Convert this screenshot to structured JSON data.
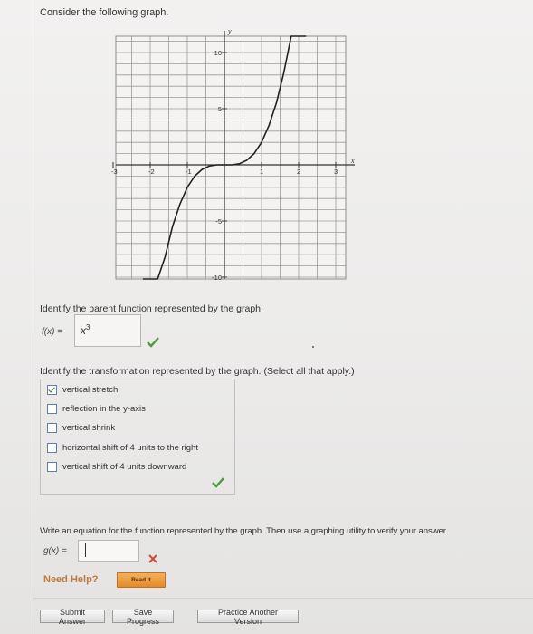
{
  "heading": "Consider the following graph.",
  "chart_data": {
    "type": "line",
    "function": "y = 2x^3 grid plot",
    "series": [
      {
        "x": [
          -2.2,
          -2.0,
          -1.8,
          -1.6,
          -1.4,
          -1.2,
          -1.0,
          -0.8,
          -0.6,
          -0.4,
          -0.2,
          0,
          0.2,
          0.4,
          0.6,
          0.8,
          1.0,
          1.2,
          1.4,
          1.6,
          1.8,
          2.0,
          2.2
        ],
        "y": [
          -21.3,
          -16,
          -11.7,
          -8.2,
          -5.5,
          -3.5,
          -2,
          -1,
          -0.4,
          -0.1,
          0,
          0,
          0,
          0.1,
          0.4,
          1,
          2,
          3.5,
          5.5,
          8.2,
          11.7,
          16,
          21.3
        ]
      }
    ],
    "xlabel": "x",
    "ylabel": "y",
    "xlim": [
      -3.3,
      3.3
    ],
    "ylim": [
      -12,
      12
    ],
    "xticks": [
      "-3",
      "-2",
      "-1",
      "1",
      "2",
      "3"
    ],
    "yticks": [
      "10",
      "5",
      "-5",
      "-10"
    ],
    "grid": true
  },
  "q1": {
    "prompt": "Identify the parent function represented by the graph.",
    "label": "f(x)  =",
    "answer_base": "x",
    "answer_exp": "3"
  },
  "q2": {
    "prompt": "Identify the transformation represented by the graph. (Select all that apply.)",
    "options": [
      {
        "label": "vertical stretch",
        "checked": true
      },
      {
        "label": "reflection in the y-axis",
        "checked": false
      },
      {
        "label": "vertical shrink",
        "checked": false
      },
      {
        "label": "horizontal shift of 4 units to the right",
        "checked": false
      },
      {
        "label": "vertical shift of 4 units downward",
        "checked": false
      }
    ]
  },
  "q3": {
    "prompt": "Write an equation for the function represented by the graph. Then use a graphing utility to verify your answer.",
    "label": "g(x)  =",
    "value": ""
  },
  "help": {
    "need_help": "Need Help?",
    "read_it": "Read It"
  },
  "footer": {
    "submit": "Submit Answer",
    "save": "Save Progress",
    "practice": "Practice Another Version"
  },
  "colors": {
    "check": "#4c9a3c",
    "x_mark": "#d24a3a",
    "help_orange": "#c0773a"
  }
}
